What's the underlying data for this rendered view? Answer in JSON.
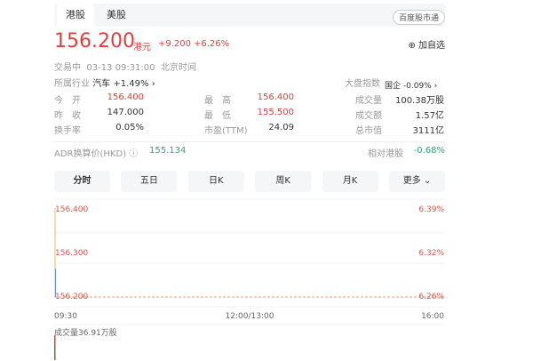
{
  "tabs": [
    "港股",
    "美股"
  ],
  "badge": "百度股市通",
  "price": "156.200",
  "currency": "港元",
  "change": "+9.200",
  "change_pct": "+6.26%",
  "add_watch": "加自选",
  "status": "交易中",
  "datetime": "03-13 09:31:00",
  "tz": "北京时间",
  "industry_label": "所属行业",
  "industry": "汽车",
  "industry_change": "+1.49%",
  "index_label": "大盘指数",
  "index_name": "国企",
  "index_change": "-0.09%",
  "stats": [
    [
      {
        "k": "今　开",
        "v": "156.400"
      },
      {
        "k": "最　高",
        "v": "156.400"
      },
      {
        "k": "成交量",
        "v": "100.38万股"
      }
    ],
    [
      {
        "k": "昨　收",
        "v": "147.000"
      },
      {
        "k": "最　低",
        "v": "155.500"
      },
      {
        "k": "成交额",
        "v": "1.57亿"
      }
    ],
    [
      {
        "k": "换手率",
        "v": "0.05%"
      },
      {
        "k": "市盈(TTM)",
        "v": "24.09"
      },
      {
        "k": "总市值",
        "v": "3111亿"
      }
    ]
  ],
  "adr_label": "ADR换算价(HKD)",
  "adr_value": "155.134",
  "rel_label": "相对港股",
  "rel_value": "-0.68%",
  "periods": [
    "分时",
    "五日",
    "日K",
    "周K",
    "月K",
    "更多"
  ],
  "chart_data": {
    "type": "line",
    "y_left_ticks": [
      "156.400",
      "156.300",
      "156.200"
    ],
    "y_right_ticks": [
      "6.39%",
      "6.32%",
      "6.26%"
    ],
    "x_ticks": [
      "09:30",
      "12:00/13:00",
      "16:00"
    ],
    "ylim": [
      156.2,
      156.4
    ],
    "series": [
      {
        "name": "price",
        "x": [
          "09:30",
          "09:31"
        ],
        "values": [
          156.4,
          156.2
        ]
      }
    ],
    "volume_label": "成交量36.91万股"
  }
}
